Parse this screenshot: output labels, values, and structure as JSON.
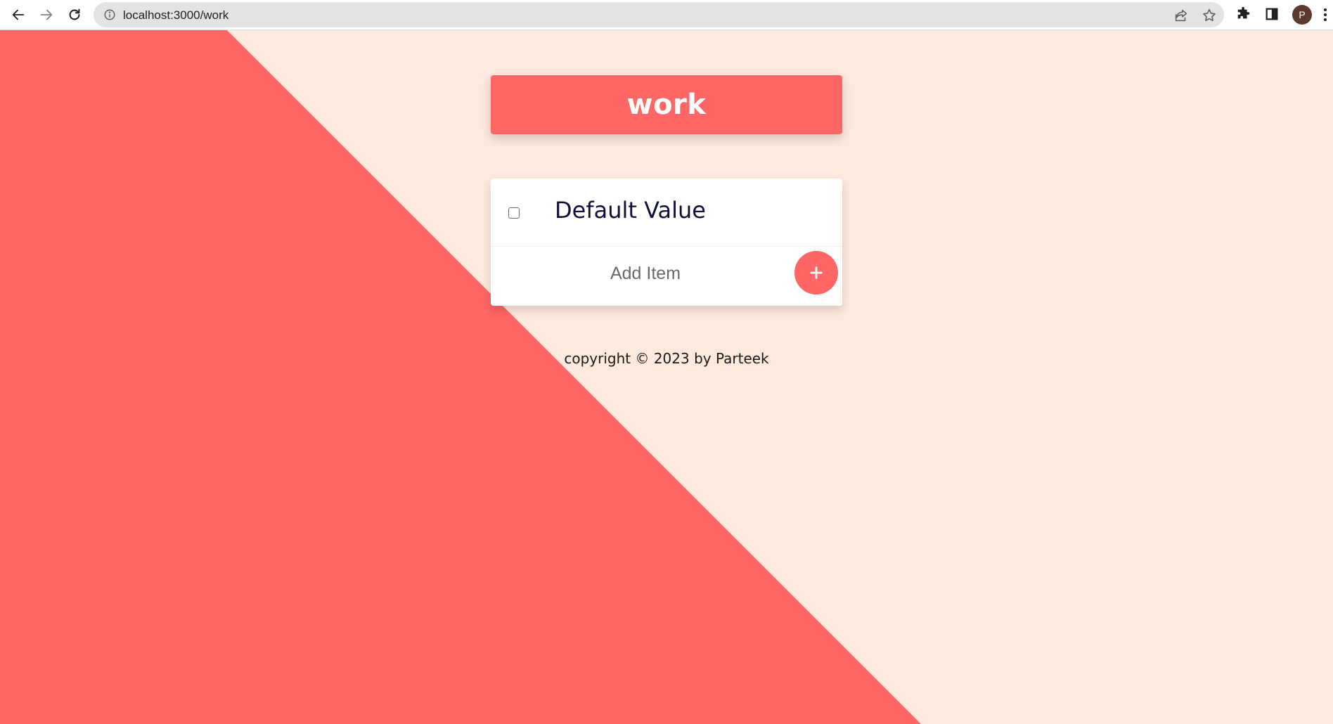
{
  "browser": {
    "url": "localhost:3000/work",
    "profile_initial": "P",
    "icons": [
      "back-arrow-icon",
      "forward-arrow-icon",
      "reload-icon",
      "info-icon",
      "share-icon",
      "star-icon",
      "extensions-icon",
      "side-panel-icon",
      "more-menu-icon"
    ]
  },
  "list": {
    "title": "work",
    "items": [
      {
        "label": "Default Value",
        "checked": false
      }
    ],
    "add_placeholder": "Add Item",
    "add_button_label": "+"
  },
  "footer": {
    "text": "copyright © 2023 by Parteek"
  },
  "colors": {
    "accent": "#FF6666",
    "background": "#FFE9DE",
    "card": "#FFFFFF",
    "item_text": "#0F0F3D"
  }
}
